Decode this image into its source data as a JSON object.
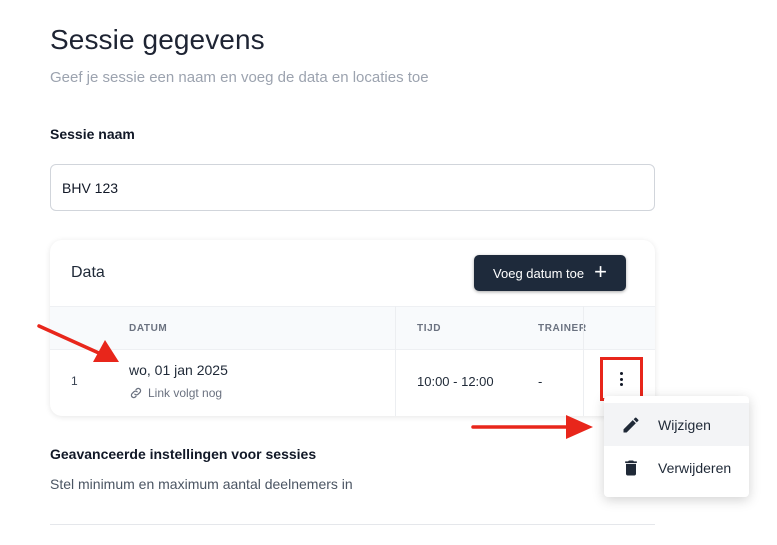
{
  "header": {
    "title": "Sessie gegevens",
    "subtitle": "Geef je sessie een naam en voeg de data en locaties toe"
  },
  "session_name": {
    "label": "Sessie naam",
    "value": "BHV 123"
  },
  "data_card": {
    "title": "Data",
    "add_button_label": "Voeg datum toe",
    "columns": [
      "",
      "DATUM",
      "TIJD",
      "TRAINER"
    ],
    "rows": [
      {
        "index": "1",
        "date": "wo, 01 jan 2025",
        "link_text": "Link volgt nog",
        "time": "10:00 - 12:00",
        "trainer": "-"
      }
    ]
  },
  "context_menu": {
    "items": [
      {
        "label": "Wijzigen",
        "icon": "pencil-icon"
      },
      {
        "label": "Verwijderen",
        "icon": "trash-icon"
      }
    ]
  },
  "advanced": {
    "title": "Geavanceerde instellingen voor sessies",
    "description": "Stel minimum en maximum aantal deelnemers in"
  },
  "colors": {
    "primary_button": "#1e2a3b",
    "annotation": "#e8261b"
  }
}
